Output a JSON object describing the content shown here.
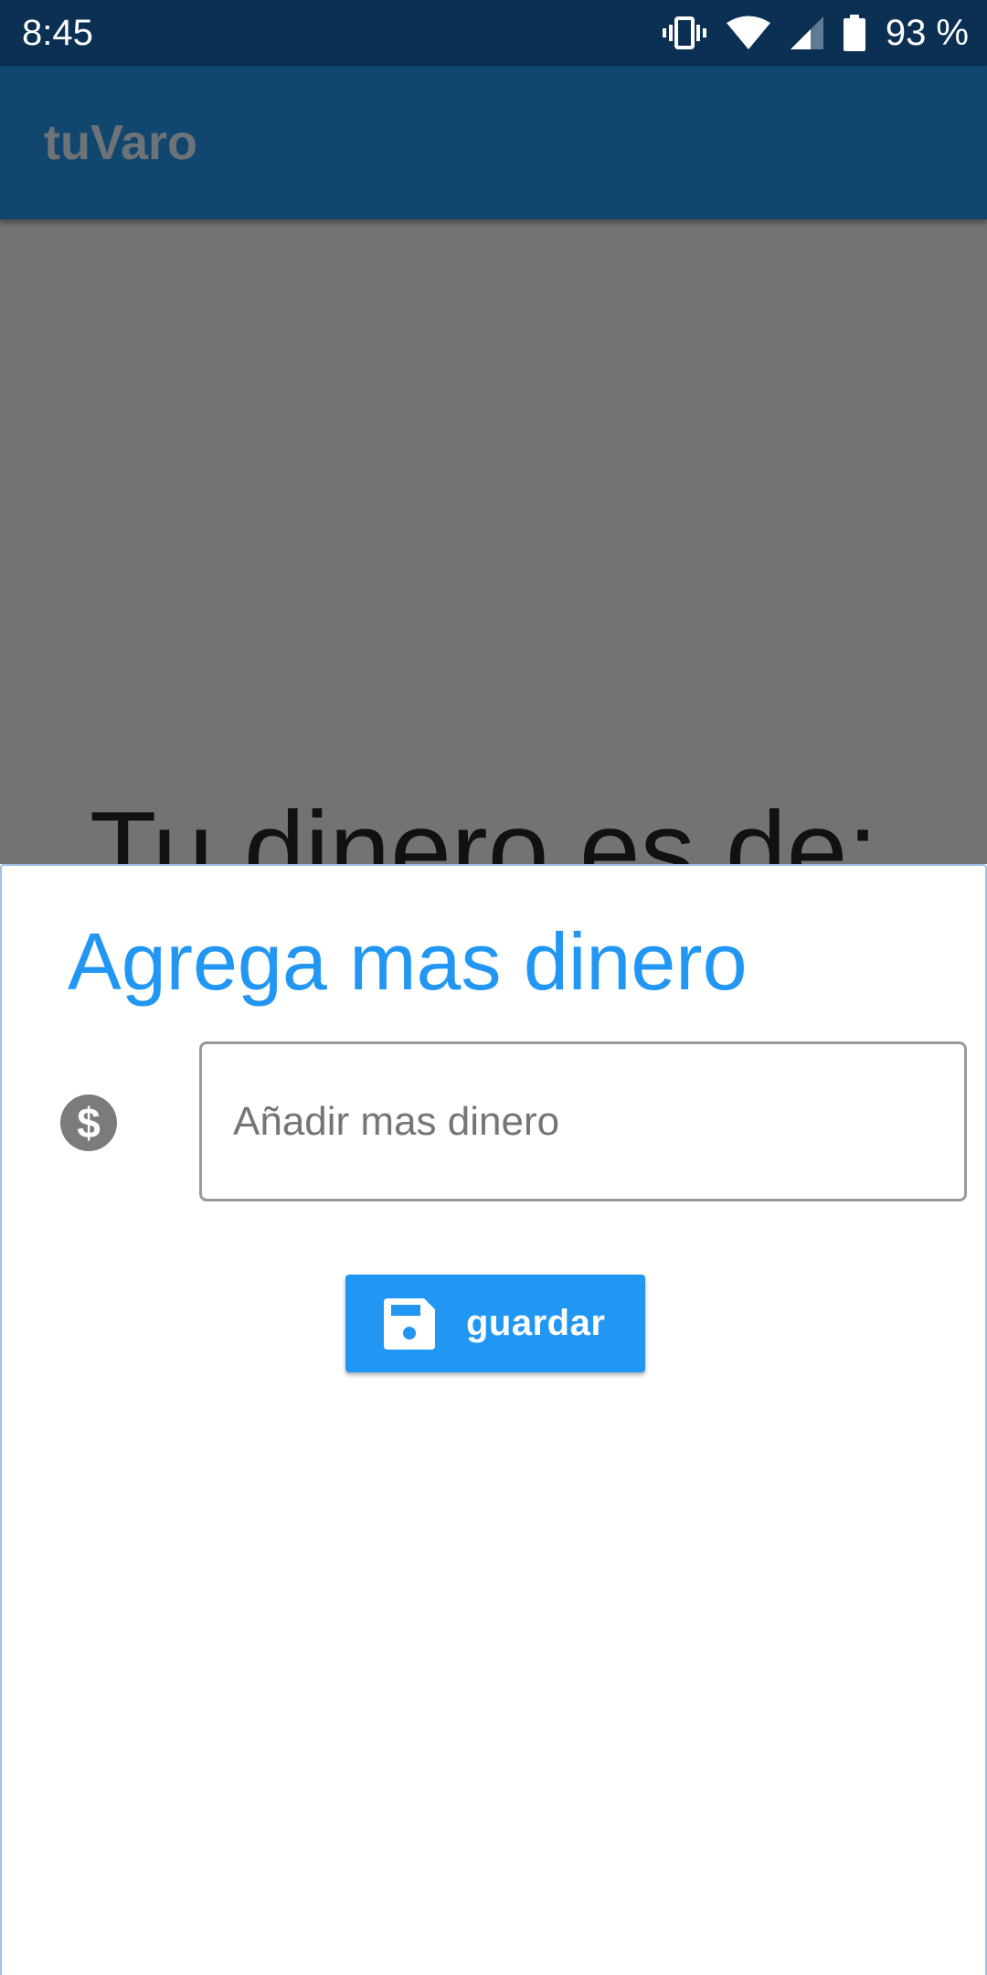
{
  "status_bar": {
    "time": "8:45",
    "battery_percent": "93 %",
    "icons": [
      "vibrate-icon",
      "wifi-icon",
      "signal-icon",
      "battery-icon"
    ]
  },
  "app_bar": {
    "title": "tuVaro"
  },
  "main": {
    "balance_heading": "Tu dinero es de:"
  },
  "add_money_sheet": {
    "title": "Agrega mas dinero",
    "input": {
      "value": "",
      "placeholder": "Añadir mas dinero",
      "icon": "dollar-circle-icon"
    },
    "save_button": {
      "label": "guardar",
      "icon": "floppy-disk-icon"
    }
  },
  "colors": {
    "status_bar": "#0c3053",
    "app_bar": "#11466f",
    "scrim": "#737373",
    "accent": "#2196f3",
    "sheet_background": "#ffffff"
  }
}
